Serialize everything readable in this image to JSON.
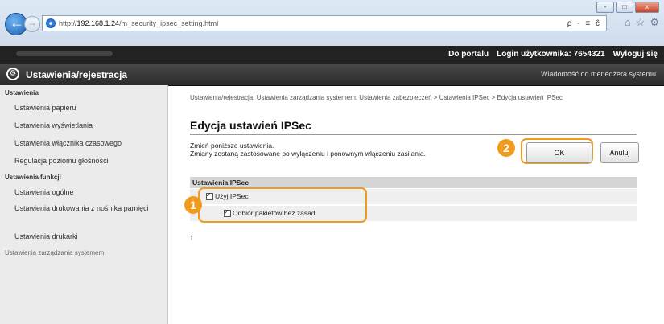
{
  "browser": {
    "url_host": "192.168.1.24",
    "url_prefix": "http://",
    "url_path": "/m_security_ipsec_setting.html",
    "addr_controls": "ρ - ≡ ĉ",
    "window_controls": [
      "-",
      "□",
      "x"
    ]
  },
  "portal": {
    "portal_link": "Do portalu",
    "login_label": "Login użytkownika:",
    "login_value": "7654321",
    "logout": "Wyloguj się"
  },
  "settings_bar": {
    "title": "Ustawienia/rejestracja",
    "message_link": "Wiadomość do menedżera systemu"
  },
  "sidebar": {
    "section1": "Ustawienia",
    "items1": [
      "Ustawienia papieru",
      "Ustawienia wyświetlania",
      "Ustawienia włącznika czasowego",
      "Regulacja poziomu głośności"
    ],
    "section2": "Ustawienia funkcji",
    "items2": [
      "Ustawienia ogólne",
      "Ustawienia drukowania z nośnika pamięci",
      "Ustawienia drukarki"
    ],
    "section3": "Ustawienia zarządzania systemem"
  },
  "main": {
    "breadcrumb": "Ustawienia/rejestracja: Ustawienia zarządzania systemem: Ustawienia zabezpieczeń > Ustawienia IPSec > Edycja ustawień IPSec",
    "title": "Edycja ustawień IPSec",
    "desc_line1": "Zmień poniższe ustawienia.",
    "desc_line2": "Zmiany zostaną zastosowane po wyłączeniu i ponownym włączeniu zasilania.",
    "ok_label": "OK",
    "cancel_label": "Anuluj",
    "section_title": "Ustawienia IPSec",
    "use_ipsec_label": "Użyj IPSec",
    "use_ipsec_checked": true,
    "receive_label": "Odbiór pakietów bez zasad",
    "receive_checked": true,
    "to_top": "⭡"
  },
  "callouts": {
    "marker1": "1",
    "marker2": "2",
    "accent_color": "#f29a1d"
  }
}
